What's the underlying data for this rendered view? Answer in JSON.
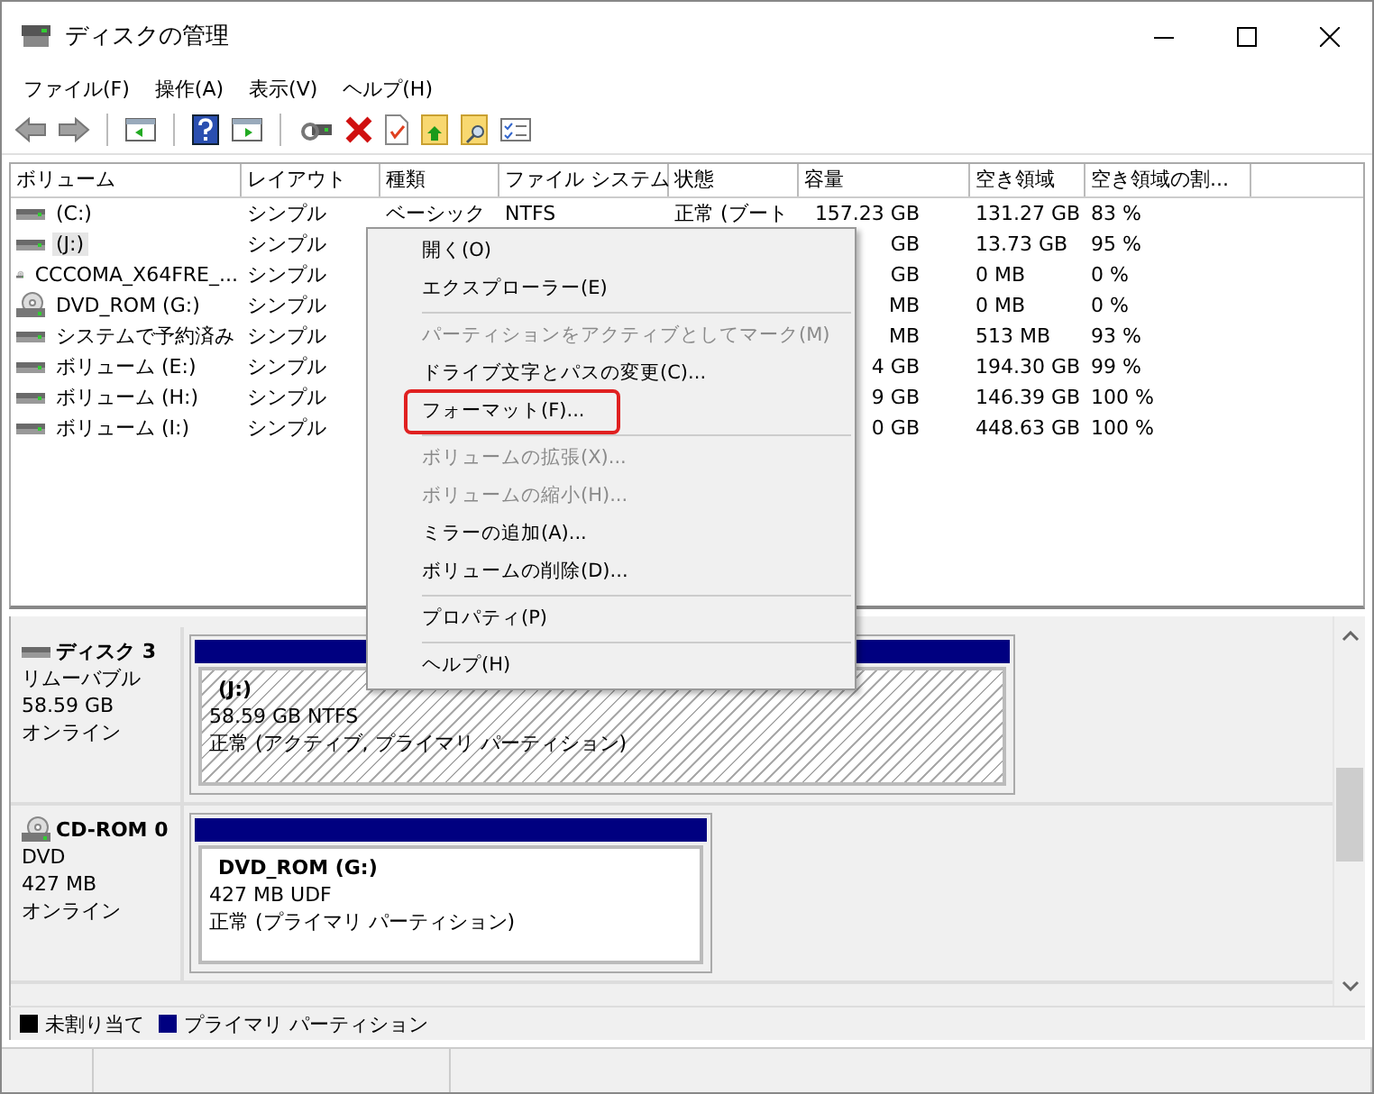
{
  "window": {
    "title": "ディスクの管理"
  },
  "menu_bar": [
    "ファイル(F)",
    "操作(A)",
    "表示(V)",
    "ヘルプ(H)"
  ],
  "toolbar": [
    {
      "kind": "back",
      "disabled": true
    },
    {
      "kind": "forward",
      "disabled": true
    },
    {
      "kind": "sep"
    },
    {
      "kind": "pane"
    },
    {
      "kind": "sep"
    },
    {
      "kind": "help"
    },
    {
      "kind": "pane2"
    },
    {
      "kind": "sep"
    },
    {
      "kind": "connect"
    },
    {
      "kind": "delete"
    },
    {
      "kind": "check"
    },
    {
      "kind": "folder-up"
    },
    {
      "kind": "folder-search"
    },
    {
      "kind": "list"
    }
  ],
  "table": {
    "columns": [
      "ボリューム",
      "レイアウト",
      "種類",
      "ファイル システム",
      "状態",
      "容量",
      "空き領域",
      "空き領域の割..."
    ],
    "rows": [
      {
        "kind": "disk",
        "selected": false,
        "volume": "(C:)",
        "layout": "シンプル",
        "type": "ベーシック",
        "fs": "NTFS",
        "status": "正常 (ブート",
        "capacity": "157.23 GB",
        "free": "131.27 GB",
        "percent": "83 %"
      },
      {
        "kind": "disk",
        "selected": true,
        "volume": "(J:)",
        "layout": "シンプル",
        "capacity": "GB",
        "free": "13.73 GB",
        "percent": "95 %"
      },
      {
        "kind": "cd",
        "selected": false,
        "volume": "CCCOMA_X64FRE_...",
        "layout": "シンプル",
        "capacity": "GB",
        "free": "0 MB",
        "percent": "0 %"
      },
      {
        "kind": "cd",
        "selected": false,
        "volume": "DVD_ROM (G:)",
        "layout": "シンプル",
        "capacity": "MB",
        "free": "0 MB",
        "percent": "0 %"
      },
      {
        "kind": "disk",
        "selected": false,
        "volume": "システムで予約済み",
        "layout": "シンプル",
        "capacity": "MB",
        "free": "513 MB",
        "percent": "93 %"
      },
      {
        "kind": "disk",
        "selected": false,
        "volume": "ボリューム (E:)",
        "layout": "シンプル",
        "capacity": "4 GB",
        "free": "194.30 GB",
        "percent": "99 %"
      },
      {
        "kind": "disk",
        "selected": false,
        "volume": "ボリューム (H:)",
        "layout": "シンプル",
        "capacity": "9 GB",
        "free": "146.39 GB",
        "percent": "100 %"
      },
      {
        "kind": "disk",
        "selected": false,
        "volume": "ボリューム (I:)",
        "layout": "シンプル",
        "capacity": "0 GB",
        "free": "448.63 GB",
        "percent": "100 %"
      }
    ]
  },
  "context_menu": [
    {
      "kind": "item",
      "label": "開く(O)",
      "disabled": false,
      "highlighted": false
    },
    {
      "kind": "item",
      "label": "エクスプローラー(E)",
      "disabled": false,
      "highlighted": false
    },
    {
      "kind": "separator"
    },
    {
      "kind": "item",
      "label": "パーティションをアクティブとしてマーク(M)",
      "disabled": true,
      "highlighted": false
    },
    {
      "kind": "item",
      "label": "ドライブ文字とパスの変更(C)...",
      "disabled": false,
      "highlighted": false
    },
    {
      "kind": "item",
      "label": "フォーマット(F)...",
      "disabled": false,
      "highlighted": true
    },
    {
      "kind": "separator"
    },
    {
      "kind": "item",
      "label": "ボリュームの拡張(X)...",
      "disabled": true,
      "highlighted": false
    },
    {
      "kind": "item",
      "label": "ボリュームの縮小(H)...",
      "disabled": true,
      "highlighted": false
    },
    {
      "kind": "item",
      "label": "ミラーの追加(A)...",
      "disabled": false,
      "highlighted": false
    },
    {
      "kind": "item",
      "label": "ボリュームの削除(D)...",
      "disabled": false,
      "highlighted": false
    },
    {
      "kind": "separator"
    },
    {
      "kind": "item",
      "label": "プロパティ(P)",
      "disabled": false,
      "highlighted": false
    },
    {
      "kind": "separator"
    },
    {
      "kind": "item",
      "label": "ヘルプ(H)",
      "disabled": false,
      "highlighted": false
    }
  ],
  "disks": [
    {
      "kind": "disk",
      "name": "ディスク 3",
      "lines": [
        "リムーバブル",
        "58.59 GB",
        "オンライン"
      ],
      "partition": {
        "selected": true,
        "title": "(J:)",
        "size": "58.59 GB NTFS",
        "status": "正常 (アクティブ, プライマリ パーティション)"
      }
    },
    {
      "kind": "cd",
      "name": "CD-ROM 0",
      "lines": [
        "DVD",
        "427 MB",
        "オンライン"
      ],
      "partition": {
        "selected": false,
        "title": "DVD_ROM  (G:)",
        "size": "427 MB UDF",
        "status": "正常 (プライマリ パーティション)"
      }
    }
  ],
  "legend": [
    {
      "label": "未割り当て",
      "color": "#000000"
    },
    {
      "label": "プライマリ パーティション",
      "color": "#000080"
    }
  ]
}
